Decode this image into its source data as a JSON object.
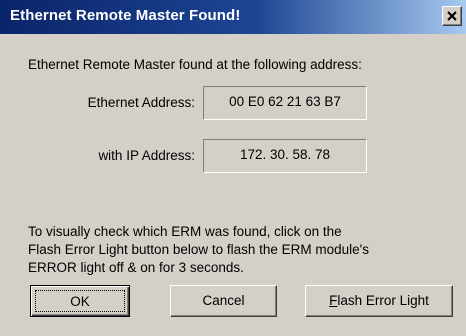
{
  "window": {
    "title": "Ethernet Remote Master Found!",
    "close_icon": "close-x-icon"
  },
  "message": {
    "intro": "Ethernet Remote Master found at the following address:"
  },
  "fields": {
    "ethernet_label": "Ethernet Address:",
    "ethernet_value": "00 E0 62 21 63 B7",
    "ip_label": "with IP Address:",
    "ip_value": "172. 30. 58. 78"
  },
  "instructions": {
    "line1": "To visually check which ERM was found, click on the",
    "line2": "Flash Error Light button below to flash the ERM module's",
    "line3": "ERROR light off & on for 3 seconds."
  },
  "buttons": {
    "ok_label": "OK",
    "cancel_label": "Cancel",
    "flash_mnemonic": "F",
    "flash_rest": "lash Error Light"
  },
  "colors": {
    "titlebar_start": "#0a246a",
    "titlebar_end": "#a6caf0",
    "dialog_bg": "#d4d0c8"
  }
}
